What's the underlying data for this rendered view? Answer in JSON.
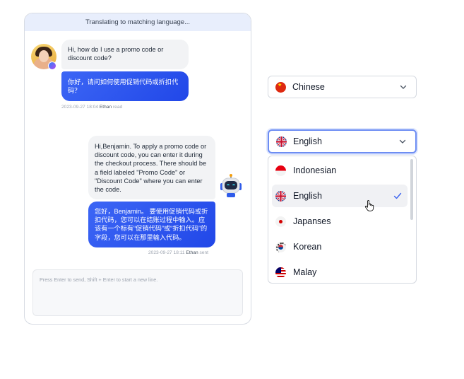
{
  "chat": {
    "banner": "Translating to matching language...",
    "messages": [
      {
        "text": "Hi, how do I use a promo code or discount code?"
      },
      {
        "text": "你好，请问如何使用促销代码或折扣代码？"
      },
      {
        "text": "Hi,Benjamin. To apply a promo code or discount code, you can enter it during the checkout process. There should be a field labeled \"Promo Code\" or \"Discount Code\" where you can enter the code."
      },
      {
        "text": "您好，Benjamin。 要使用促销代码或折扣代码，您可以在结账过程中输入。应该有一个标有“促销代码”或“折扣代码”的字段，您可以在那里输入代码。"
      }
    ],
    "meta1": {
      "time": "2023-09-27 18:04",
      "name": "Ethan",
      "status": "read"
    },
    "meta2": {
      "time": "2023-09-27 18:11",
      "name": "Ethan",
      "status": "sent"
    },
    "composer_placeholder": "Press Enter to send,  Shift + Enter to start a new line."
  },
  "language_select_source": {
    "value": "Chinese",
    "flag": "china-flag-icon"
  },
  "language_select_target": {
    "value": "English",
    "flag": "uk-flag-icon"
  },
  "dropdown": {
    "options": [
      {
        "label": "Indonesian",
        "flag": "indonesia-flag-icon"
      },
      {
        "label": "English",
        "flag": "uk-flag-icon",
        "selected": true
      },
      {
        "label": "Japanses",
        "flag": "japan-flag-icon"
      },
      {
        "label": "Korean",
        "flag": "korea-flag-icon"
      },
      {
        "label": "Malay",
        "flag": "malaysia-flag-icon"
      }
    ]
  },
  "colors": {
    "accent": "#2d55ee",
    "banner": "#e8eefc",
    "focus_ring": "#6d8df3"
  }
}
